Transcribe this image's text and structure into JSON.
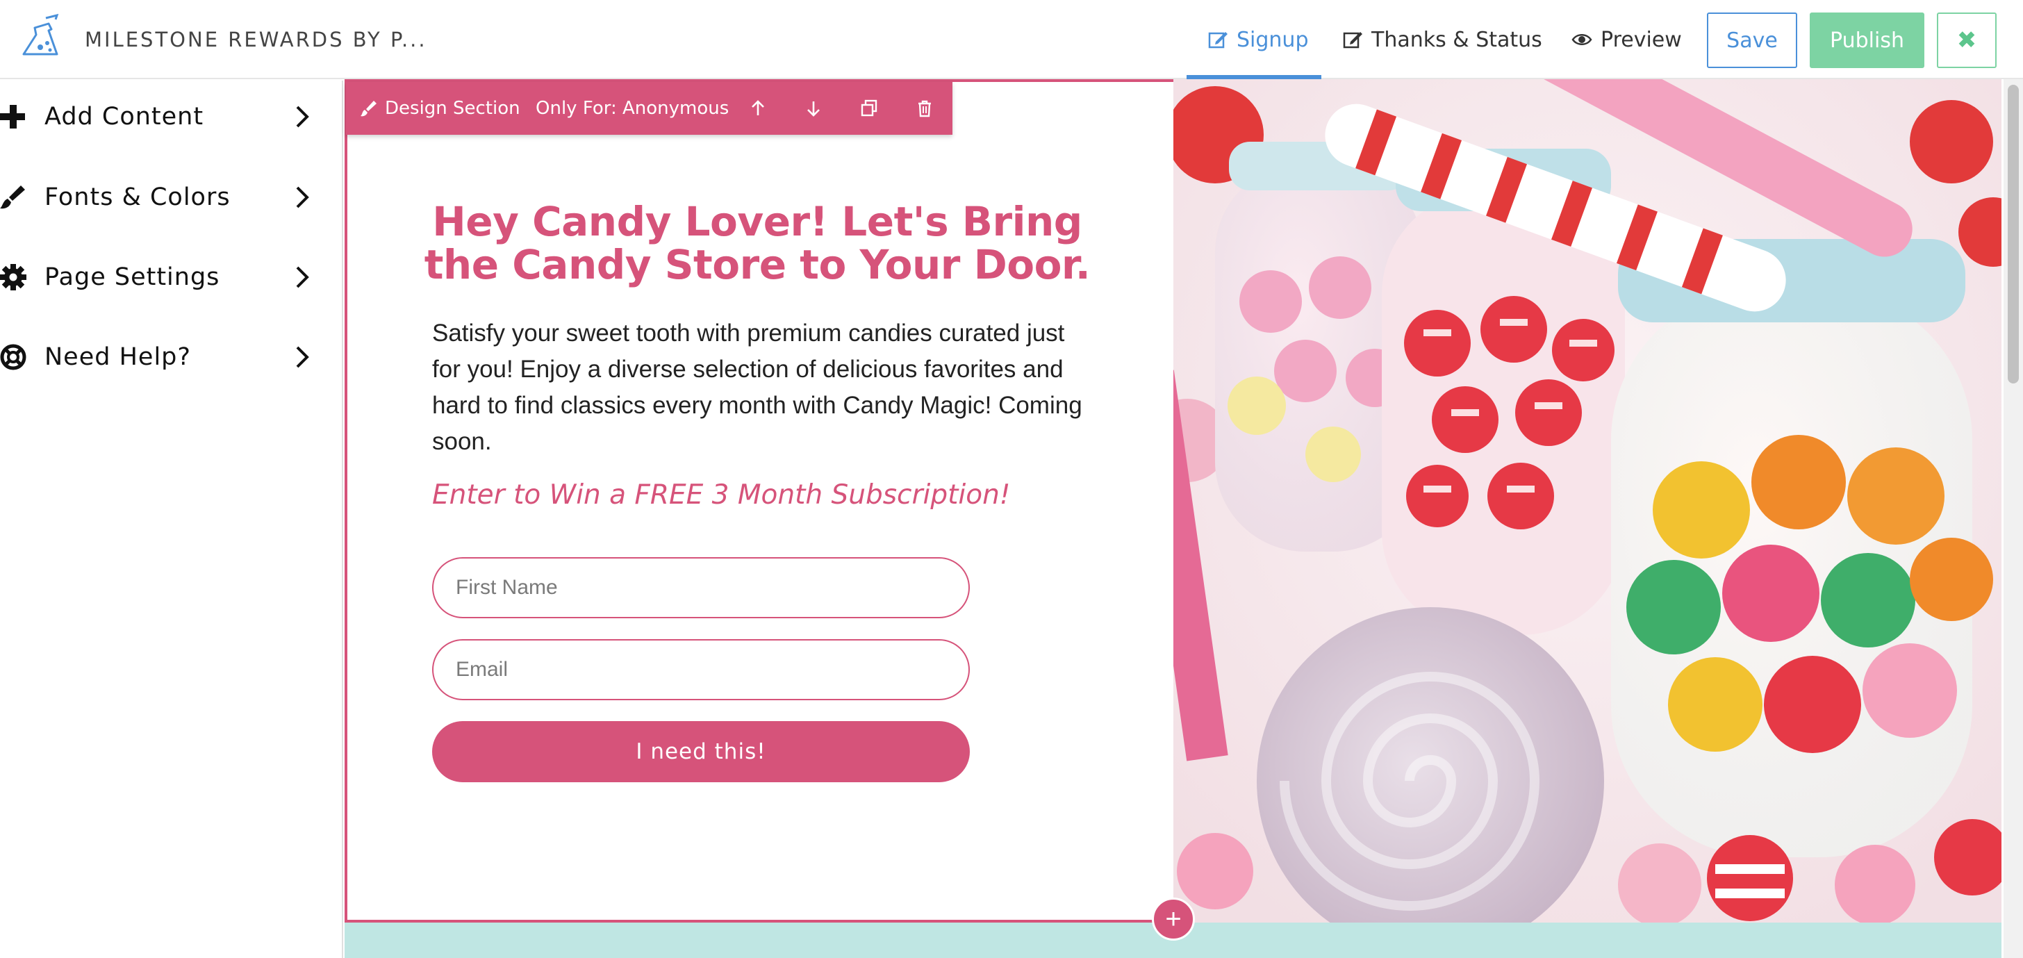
{
  "app": {
    "title": "MILESTONE REWARDS BY P..."
  },
  "tabs": [
    {
      "label": "Signup",
      "icon": "edit-icon",
      "active": true
    },
    {
      "label": "Thanks & Status",
      "icon": "edit-icon",
      "active": false
    },
    {
      "label": "Preview",
      "icon": "eye-icon",
      "active": false
    }
  ],
  "actions": {
    "save": "Save",
    "publish": "Publish",
    "close": "✖"
  },
  "sidebar": {
    "items": [
      {
        "label": "Add Content",
        "icon": "plus-icon"
      },
      {
        "label": "Fonts & Colors",
        "icon": "brush-icon"
      },
      {
        "label": "Page Settings",
        "icon": "gear-icon"
      },
      {
        "label": "Need Help?",
        "icon": "lifebuoy-icon"
      }
    ]
  },
  "section_toolbar": {
    "design": "Design Section",
    "visibility": "Only For: Anonymous"
  },
  "content": {
    "headline": "Hey Candy Lover! Let's Bring the Candy Store to Your Door.",
    "body": "Satisfy your sweet tooth with premium candies curated just for you! Enjoy a diverse selection of delicious favorites and hard to find classics every month with Candy Magic! Coming soon.",
    "subhead": "Enter to Win a FREE 3 Month Subscription!",
    "form": {
      "first_name_placeholder": "First Name",
      "email_placeholder": "Email",
      "submit_label": "I need this!"
    },
    "add_section": "+"
  },
  "colors": {
    "accent": "#d6537a",
    "primary": "#4a90d9",
    "publish": "#7dd3a3",
    "next_section_bg": "#bfe6e3"
  }
}
